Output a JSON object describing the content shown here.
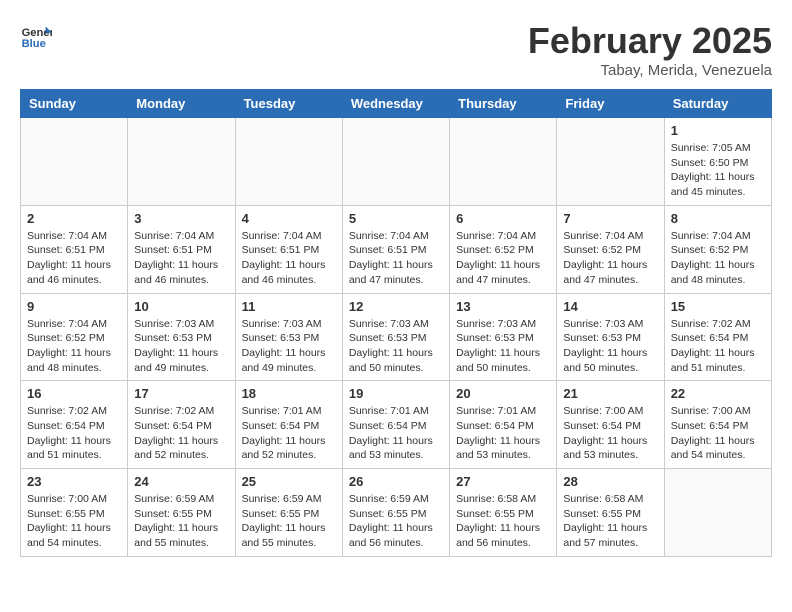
{
  "header": {
    "logo_general": "General",
    "logo_blue": "Blue",
    "month": "February 2025",
    "location": "Tabay, Merida, Venezuela"
  },
  "weekdays": [
    "Sunday",
    "Monday",
    "Tuesday",
    "Wednesday",
    "Thursday",
    "Friday",
    "Saturday"
  ],
  "weeks": [
    [
      {
        "day": "",
        "info": ""
      },
      {
        "day": "",
        "info": ""
      },
      {
        "day": "",
        "info": ""
      },
      {
        "day": "",
        "info": ""
      },
      {
        "day": "",
        "info": ""
      },
      {
        "day": "",
        "info": ""
      },
      {
        "day": "1",
        "info": "Sunrise: 7:05 AM\nSunset: 6:50 PM\nDaylight: 11 hours\nand 45 minutes."
      }
    ],
    [
      {
        "day": "2",
        "info": "Sunrise: 7:04 AM\nSunset: 6:51 PM\nDaylight: 11 hours\nand 46 minutes."
      },
      {
        "day": "3",
        "info": "Sunrise: 7:04 AM\nSunset: 6:51 PM\nDaylight: 11 hours\nand 46 minutes."
      },
      {
        "day": "4",
        "info": "Sunrise: 7:04 AM\nSunset: 6:51 PM\nDaylight: 11 hours\nand 46 minutes."
      },
      {
        "day": "5",
        "info": "Sunrise: 7:04 AM\nSunset: 6:51 PM\nDaylight: 11 hours\nand 47 minutes."
      },
      {
        "day": "6",
        "info": "Sunrise: 7:04 AM\nSunset: 6:52 PM\nDaylight: 11 hours\nand 47 minutes."
      },
      {
        "day": "7",
        "info": "Sunrise: 7:04 AM\nSunset: 6:52 PM\nDaylight: 11 hours\nand 47 minutes."
      },
      {
        "day": "8",
        "info": "Sunrise: 7:04 AM\nSunset: 6:52 PM\nDaylight: 11 hours\nand 48 minutes."
      }
    ],
    [
      {
        "day": "9",
        "info": "Sunrise: 7:04 AM\nSunset: 6:52 PM\nDaylight: 11 hours\nand 48 minutes."
      },
      {
        "day": "10",
        "info": "Sunrise: 7:03 AM\nSunset: 6:53 PM\nDaylight: 11 hours\nand 49 minutes."
      },
      {
        "day": "11",
        "info": "Sunrise: 7:03 AM\nSunset: 6:53 PM\nDaylight: 11 hours\nand 49 minutes."
      },
      {
        "day": "12",
        "info": "Sunrise: 7:03 AM\nSunset: 6:53 PM\nDaylight: 11 hours\nand 50 minutes."
      },
      {
        "day": "13",
        "info": "Sunrise: 7:03 AM\nSunset: 6:53 PM\nDaylight: 11 hours\nand 50 minutes."
      },
      {
        "day": "14",
        "info": "Sunrise: 7:03 AM\nSunset: 6:53 PM\nDaylight: 11 hours\nand 50 minutes."
      },
      {
        "day": "15",
        "info": "Sunrise: 7:02 AM\nSunset: 6:54 PM\nDaylight: 11 hours\nand 51 minutes."
      }
    ],
    [
      {
        "day": "16",
        "info": "Sunrise: 7:02 AM\nSunset: 6:54 PM\nDaylight: 11 hours\nand 51 minutes."
      },
      {
        "day": "17",
        "info": "Sunrise: 7:02 AM\nSunset: 6:54 PM\nDaylight: 11 hours\nand 52 minutes."
      },
      {
        "day": "18",
        "info": "Sunrise: 7:01 AM\nSunset: 6:54 PM\nDaylight: 11 hours\nand 52 minutes."
      },
      {
        "day": "19",
        "info": "Sunrise: 7:01 AM\nSunset: 6:54 PM\nDaylight: 11 hours\nand 53 minutes."
      },
      {
        "day": "20",
        "info": "Sunrise: 7:01 AM\nSunset: 6:54 PM\nDaylight: 11 hours\nand 53 minutes."
      },
      {
        "day": "21",
        "info": "Sunrise: 7:00 AM\nSunset: 6:54 PM\nDaylight: 11 hours\nand 53 minutes."
      },
      {
        "day": "22",
        "info": "Sunrise: 7:00 AM\nSunset: 6:54 PM\nDaylight: 11 hours\nand 54 minutes."
      }
    ],
    [
      {
        "day": "23",
        "info": "Sunrise: 7:00 AM\nSunset: 6:55 PM\nDaylight: 11 hours\nand 54 minutes."
      },
      {
        "day": "24",
        "info": "Sunrise: 6:59 AM\nSunset: 6:55 PM\nDaylight: 11 hours\nand 55 minutes."
      },
      {
        "day": "25",
        "info": "Sunrise: 6:59 AM\nSunset: 6:55 PM\nDaylight: 11 hours\nand 55 minutes."
      },
      {
        "day": "26",
        "info": "Sunrise: 6:59 AM\nSunset: 6:55 PM\nDaylight: 11 hours\nand 56 minutes."
      },
      {
        "day": "27",
        "info": "Sunrise: 6:58 AM\nSunset: 6:55 PM\nDaylight: 11 hours\nand 56 minutes."
      },
      {
        "day": "28",
        "info": "Sunrise: 6:58 AM\nSunset: 6:55 PM\nDaylight: 11 hours\nand 57 minutes."
      },
      {
        "day": "",
        "info": ""
      }
    ]
  ]
}
